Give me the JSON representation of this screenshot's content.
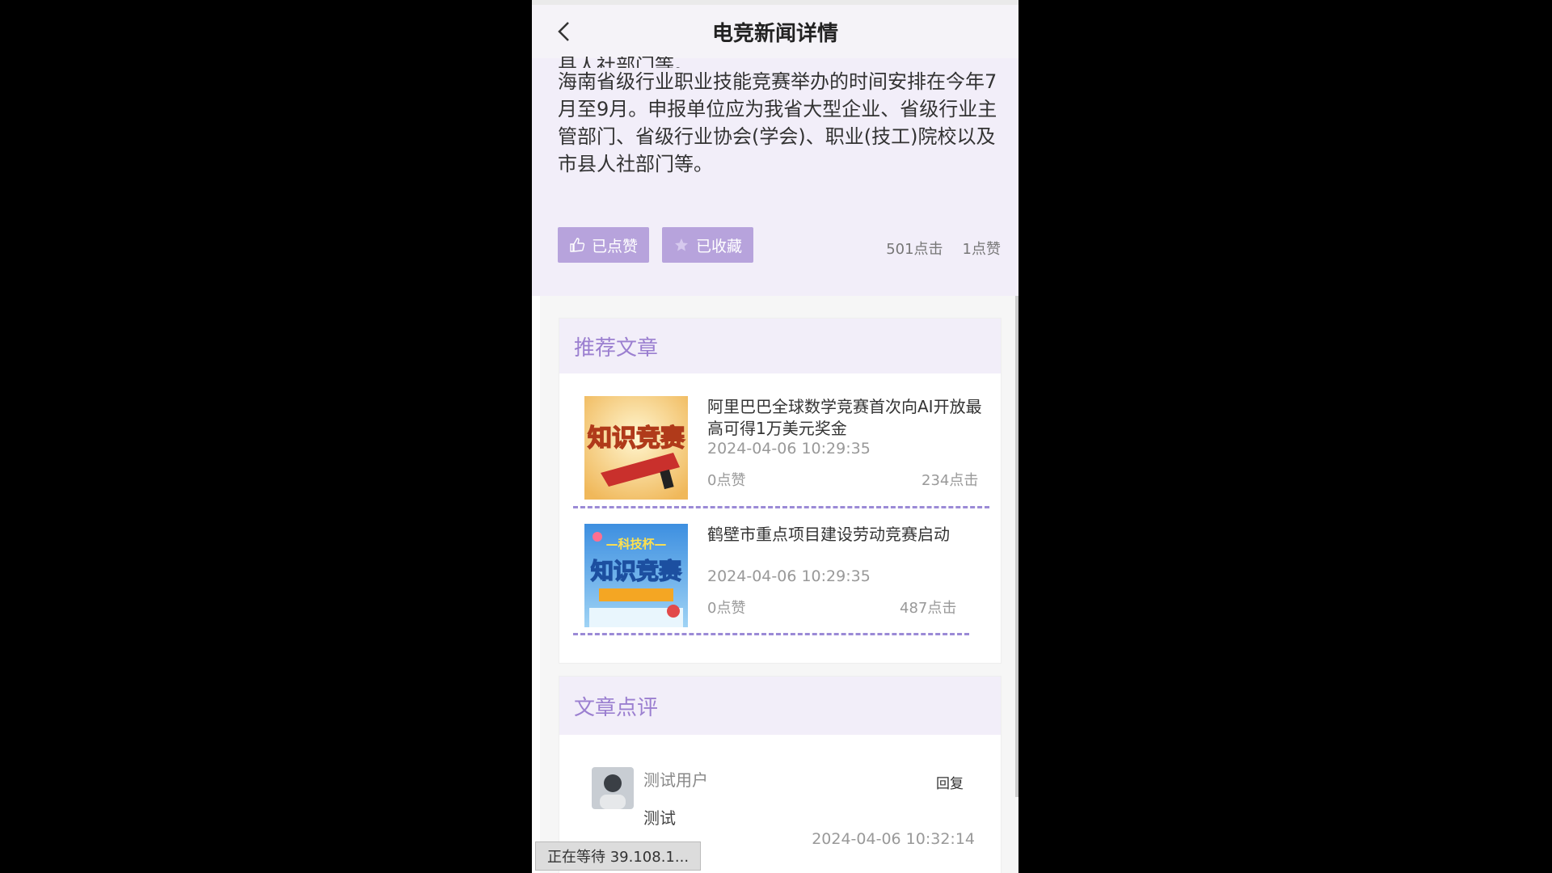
{
  "header": {
    "title": "电竞新闻详情"
  },
  "article": {
    "clipped_line": "县人社部门等。",
    "paragraph": "海南省级行业职业技能竞赛举办的时间安排在今年7月至9月。申报单位应为我省大型企业、省级行业主管部门、省级行业协会(学会)、职业(技工)院校以及市县人社部门等。",
    "like_button": "已点赞",
    "favorite_button": "已收藏",
    "clicks": "501点击",
    "likes": "1点赞"
  },
  "recommended": {
    "heading": "推荐文章",
    "items": [
      {
        "title": "阿里巴巴全球数学竞赛首次向AI开放最高可得1万美元奖金",
        "date": "2024-04-06 10:29:35",
        "likes": "0点赞",
        "clicks": "234点击",
        "thumb_text": "知识竞赛"
      },
      {
        "title": "鹤壁市重点项目建设劳动竞赛启动",
        "date": "2024-04-06 10:29:35",
        "likes": "0点赞",
        "clicks": "487点击",
        "thumb_text_top": "—科技杯—",
        "thumb_text": "知识竞赛"
      }
    ]
  },
  "comments": {
    "heading": "文章点评",
    "items": [
      {
        "user": "测试用户",
        "text": "测试",
        "reply": "回复",
        "date": "2024-04-06 10:32:14"
      }
    ]
  },
  "status": {
    "text": "正在等待 39.108.1..."
  },
  "colors": {
    "accent": "#9b7fd0",
    "button": "#b7a3dc",
    "panel_bg": "#f2eef9"
  }
}
